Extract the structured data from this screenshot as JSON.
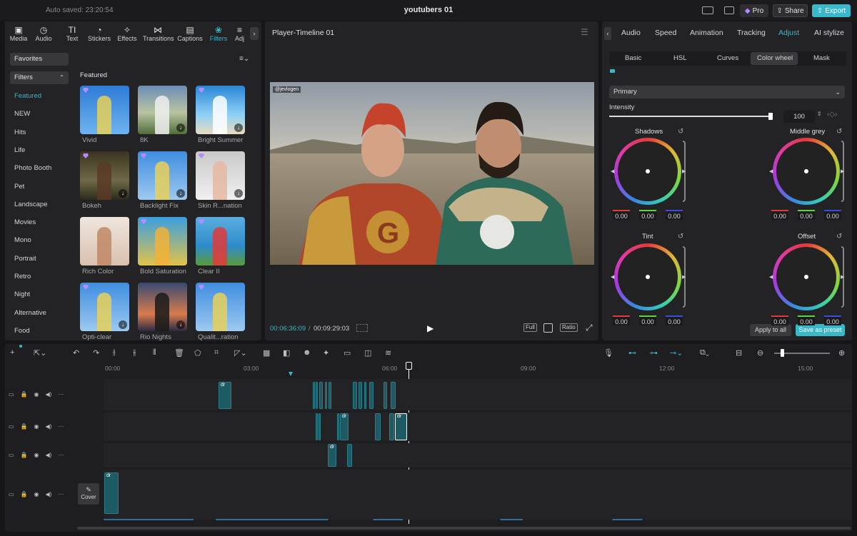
{
  "titlebar": {
    "autosave": "Auto saved: 23:20:54",
    "title": "youtubers 01",
    "pro": "Pro",
    "share": "Share",
    "export": "Export"
  },
  "tools": [
    {
      "label": "Media",
      "icon": "media-icon",
      "glyph": "▣"
    },
    {
      "label": "Audio",
      "icon": "audio-icon",
      "glyph": "◷"
    },
    {
      "label": "Text",
      "icon": "text-icon",
      "glyph": "TI"
    },
    {
      "label": "Stickers",
      "icon": "stickers-icon",
      "glyph": "◔"
    },
    {
      "label": "Effects",
      "icon": "effects-icon",
      "glyph": "✧"
    },
    {
      "label": "Transitions",
      "icon": "transitions-icon",
      "glyph": "⋈"
    },
    {
      "label": "Captions",
      "icon": "captions-icon",
      "glyph": "▤"
    },
    {
      "label": "Filters",
      "icon": "filters-icon",
      "glyph": "❀"
    },
    {
      "label": "Adj",
      "icon": "adjust-icon",
      "glyph": "≡"
    }
  ],
  "sidebar": {
    "favorites": "Favorites",
    "filters": "Filters",
    "categories": [
      "Featured",
      "NEW",
      "Hits",
      "Life",
      "Photo Booth",
      "Pet",
      "Landscape",
      "Movies",
      "Mono",
      "Portrait",
      "Retro",
      "Night",
      "Alternative",
      "Food"
    ]
  },
  "filters": {
    "heading": "Featured",
    "items": [
      {
        "label": "Vivid",
        "bg": "linear-gradient(#2e7bd6,#6fb3f0)",
        "fg": "#e6d05a",
        "gem": true,
        "dl": false
      },
      {
        "label": "8K",
        "bg": "linear-gradient(#6c8db7,#b9c3a1 55%,#516e3a)",
        "fg": "#f0f0f0",
        "gem": false,
        "dl": true
      },
      {
        "label": "Bright Summer",
        "bg": "linear-gradient(#2a86d8,#8fd0f5 60%,#e9dcc0)",
        "fg": "#ffffff",
        "gem": true,
        "dl": true
      },
      {
        "label": "Bokeh",
        "bg": "linear-gradient(#3a3420,#6f6a48 60%,#2b2a1c)",
        "fg": "#5b3a26",
        "gem": true,
        "dl": true
      },
      {
        "label": "Backlight Fix",
        "bg": "linear-gradient(#3f8de0,#9dc9f1)",
        "fg": "#e6d05a",
        "gem": true,
        "dl": true
      },
      {
        "label": "Skin R...nation",
        "bg": "linear-gradient(#c9c9c9,#f0f0f0)",
        "fg": "#e6b9a2",
        "gem": true,
        "dl": true
      },
      {
        "label": "Rich Color",
        "bg": "linear-gradient(#efe6df,#d9c0ad)",
        "fg": "#c08866",
        "gem": false,
        "dl": false
      },
      {
        "label": "Bold Saturation",
        "bg": "linear-gradient(#3a9fe0,#e2c24a)",
        "fg": "#f2b23a",
        "gem": true,
        "dl": false
      },
      {
        "label": "Clear II",
        "bg": "linear-gradient(#5aaee0,#2f8cc9 60%,#5b9b3b)",
        "fg": "#e23a3a",
        "gem": true,
        "dl": false
      },
      {
        "label": "Opti-clear",
        "bg": "linear-gradient(#3f8de0,#9dc9f1)",
        "fg": "#e6d05a",
        "gem": true,
        "dl": true
      },
      {
        "label": "Rio Nights",
        "bg": "linear-gradient(#394a72,#d97b4c 65%,#2a2a44)",
        "fg": "#1a1a1a",
        "gem": false,
        "dl": true
      },
      {
        "label": "Qualit...ration",
        "bg": "linear-gradient(#3f8de0,#9dc9f1)",
        "fg": "#e6d05a",
        "gem": true,
        "dl": false
      }
    ]
  },
  "player": {
    "title": "Player-Timeline 01",
    "watermark": "@jevlogen",
    "time_current": "00:06:36:09",
    "time_total": "00:09:29:03",
    "full": "Full",
    "ratio": "Ratio"
  },
  "right": {
    "tabs": [
      "Audio",
      "Speed",
      "Animation",
      "Tracking",
      "Adjust",
      "AI stylize"
    ],
    "active_tab": "Adjust",
    "subtabs": [
      "Basic",
      "HSL",
      "Curves",
      "Color wheel",
      "Mask"
    ],
    "active_subtab": "Color wheel",
    "mode": "Primary",
    "intensity_label": "Intensity",
    "intensity_value": "100",
    "wheels": [
      {
        "name": "Shadows",
        "r": "0.00",
        "g": "0.00",
        "b": "0.00"
      },
      {
        "name": "Middle grey",
        "r": "0.00",
        "g": "0.00",
        "b": "0.00"
      },
      {
        "name": "Tint",
        "r": "0.00",
        "g": "0.00",
        "b": "0.00"
      },
      {
        "name": "Offset",
        "r": "0.00",
        "g": "0.00",
        "b": "0.00"
      }
    ],
    "apply_all": "Apply to all",
    "save_preset": "Save as preset"
  },
  "timeline": {
    "ruler": [
      "00:00",
      "03:00",
      "06:00",
      "09:00",
      "12:00",
      "15:00"
    ],
    "cover": "Cover",
    "clip_label": "dr"
  },
  "colors": {
    "accent": "#3ab7c9",
    "clip": "#1e5a64"
  }
}
